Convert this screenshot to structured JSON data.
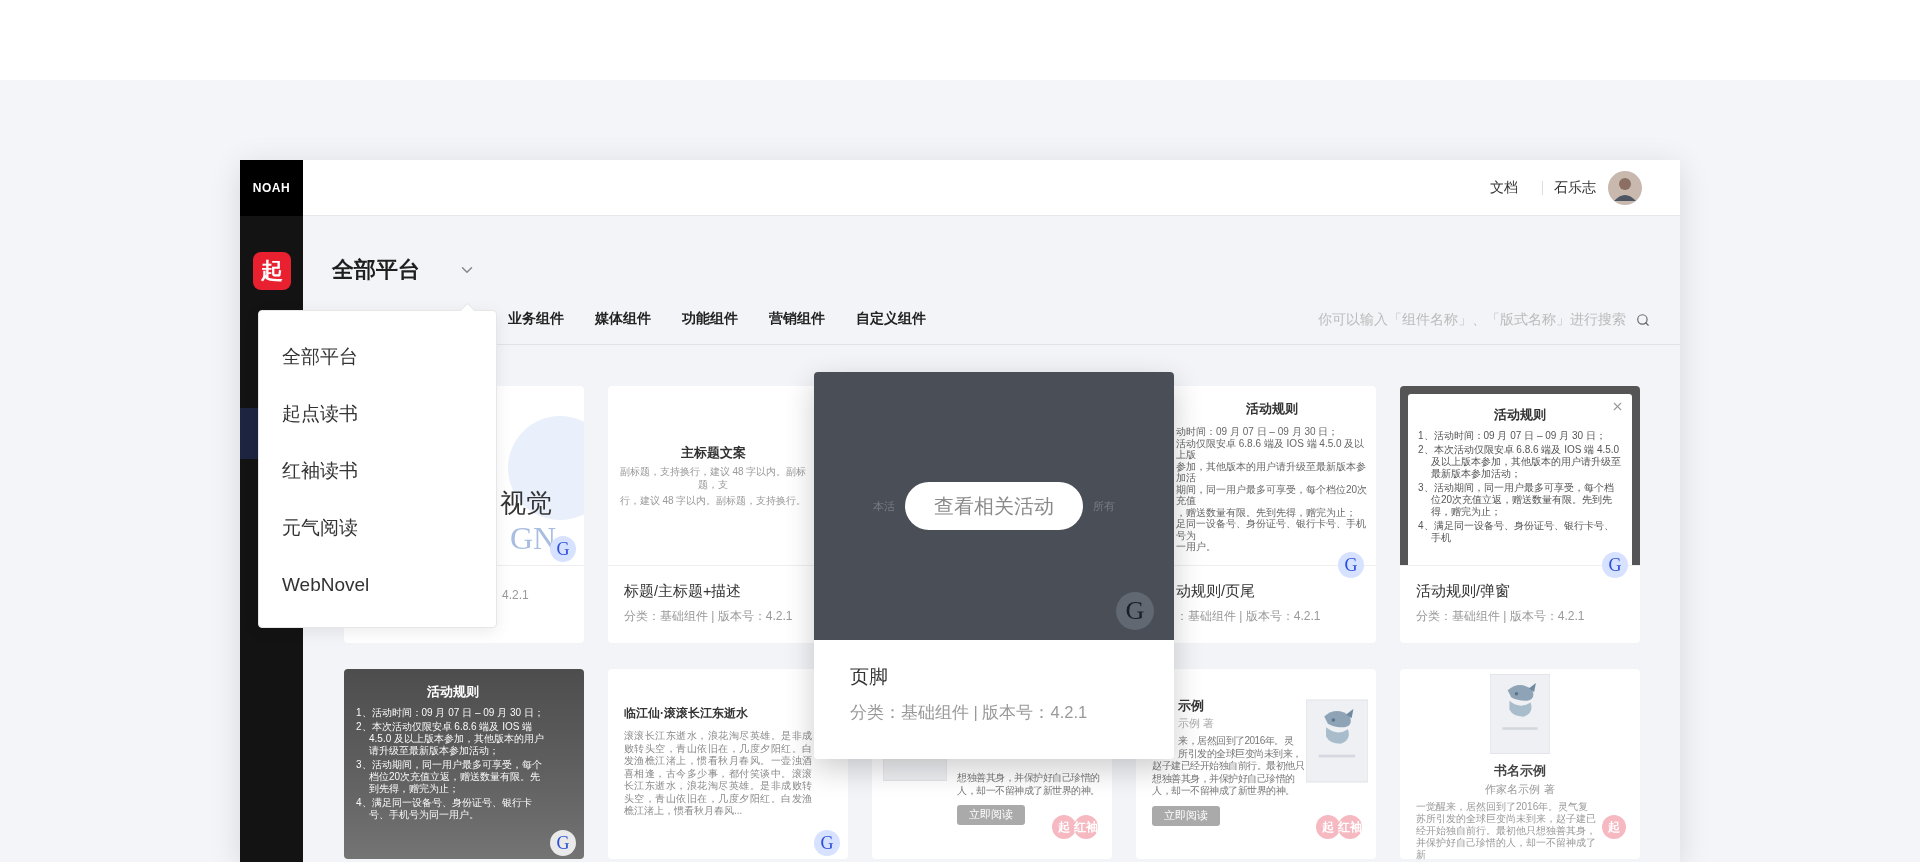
{
  "logo": "NOAH",
  "sidebar": {
    "app_icon": "起",
    "items": [
      {
        "selected": true
      }
    ]
  },
  "header": {
    "links": [
      "文档"
    ],
    "user": "石乐志"
  },
  "platform": {
    "title": "全部平台"
  },
  "tabs": [
    {
      "label": "业务组件",
      "selected": false
    },
    {
      "label": "媒体组件",
      "selected": false
    },
    {
      "label": "功能组件",
      "selected": false
    },
    {
      "label": "营销组件",
      "selected": false
    },
    {
      "label": "自定义组件",
      "selected": false
    }
  ],
  "search": {
    "placeholder": "你可以输入「组件名称」、「版式名称」进行搜索"
  },
  "dropdown": {
    "items": [
      {
        "label": "全部平台",
        "selected": false
      },
      {
        "label": "起点读书",
        "selected": false
      },
      {
        "label": "红袖读书",
        "selected": false
      },
      {
        "label": "元气阅读",
        "selected": false
      },
      {
        "label": "WebNovel",
        "selected": false
      }
    ]
  },
  "cards": [
    {
      "kind": "visual",
      "headline": "视觉",
      "deco": "GN",
      "badge": "G",
      "meta": "4.2.1"
    },
    {
      "kind": "heading",
      "heading": "主标题文案",
      "lines": [
        "副标题，支持换行，建议 48 字以内。副标题，支",
        "行，建议 48 字以内。副标题，支持换行。"
      ],
      "title": "标题/主标题+描述",
      "meta": "分类：基础组件 | 版本号：4.2.1"
    },
    {
      "kind": "popup",
      "button": "查看相关活动",
      "behind": [
        "本活",
        "所有"
      ],
      "badge": "G",
      "title": "页脚",
      "meta": "分类：基础组件 | 版本号：4.2.1"
    },
    {
      "kind": "rules",
      "heading": "活动规则",
      "lines": [
        "动时间：09 月 07 日 – 09 月 30 日；",
        "活动仅限安卓 6.8.6 端及 IOS 端 4.5.0 及以上版",
        "参加，其他版本的用户请升级至最新版本参加活",
        "期间，同一用户最多可享受，每个档位20次充值",
        "，赠送数量有限。先到先得，赠完为止；",
        "足同一设备号、身份证号、银行卡号、手机号为",
        "一用户。"
      ],
      "badge": "G",
      "title": "动规则/页尾",
      "meta": "：基础组件 | 版本号：4.2.1"
    },
    {
      "kind": "modal-rules",
      "heading": "活动规则",
      "lines": [
        "1、活动时间：09 月 07 日 – 09 月 30 日；",
        "2、本次活动仅限安卓 6.8.6 端及 IOS 端 4.5.0 及以上版本参加，其他版本的用户请升级至最新版本参加活动；",
        "3、活动期间，同一用户最多可享受，每个档位20次充值立返，赠送数量有限。先到先得，赠完为止；",
        "4、满足同一设备号、身份证号、银行卡号、手机"
      ],
      "badge": "G",
      "title": "活动规则/弹窗",
      "meta": "分类：基础组件 | 版本号：4.2.1"
    },
    {
      "kind": "dark-rules",
      "heading": "活动规则",
      "lines": [
        "1、活动时间：09 月 07 日 – 09 月 30 日；",
        "2、本次活动仅限安卓 6.8.6 端及 IOS 端 4.5.0 及以上版本参加，其他版本的用户请升级至最新版本参加活动；",
        "3、活动期间，同一用户最多可享受，每个档位20次充值立返，赠送数量有限。先到先得，赠完为止；",
        "4、满足同一设备号、身份证号、银行卡号、手机号为同一用户。"
      ],
      "badge": "G"
    },
    {
      "kind": "poem",
      "heading": "临江仙·滚滚长江东逝水",
      "text": "滚滚长江东逝水，浪花淘尽英雄。是非成败转头空，青山依旧在，几度夕阳红。白发渔樵江渚上，惯看秋月春风。一壶浊酒喜相逢，古今多少事，都付笑谈中。滚滚长江东逝水，浪花淘尽英雄。是非成败转头空，青山依旧在，几度夕阳红。白发渔樵江渚上，惯看秋月春风...",
      "badge": "G"
    },
    {
      "kind": "book-cover-left",
      "lines": [
        {
          "text": "想独善其身，并保护好自己珍惜的",
          "covered": false
        },
        {
          "text": "人，却一不留神成了新世界的神。",
          "covered": false
        }
      ],
      "button": "立即阅读",
      "badges": [
        "起",
        "红袖"
      ]
    },
    {
      "kind": "book-cover-right",
      "title": "示例",
      "author": "示例 著",
      "lines": [
        {
          "text": "来，居然回到了2016年。灵",
          "covered": true
        },
        {
          "text": "所引发的全球巨变尚未到来，",
          "covered": true
        },
        {
          "text": "赵子建已经开始独自前行。最初他只",
          "covered": false
        },
        {
          "text": "想独善其身，并保护好自己珍惜的",
          "covered": false
        },
        {
          "text": "人，却一不留神成了新世界的神。",
          "covered": false
        }
      ],
      "button": "立即阅读",
      "badges": [
        "起",
        "红袖"
      ]
    },
    {
      "kind": "book-center",
      "title": "书名示例",
      "author": "作家名示例 著",
      "text": "一觉醒来，居然回到了2016年。灵气复苏所引发的全球巨变尚未到来，赵子建已经开始独自前行。最初他只想独善其身，并保护好自己珍惜的人，却一不留神成了新",
      "badges": [
        "起"
      ]
    }
  ]
}
